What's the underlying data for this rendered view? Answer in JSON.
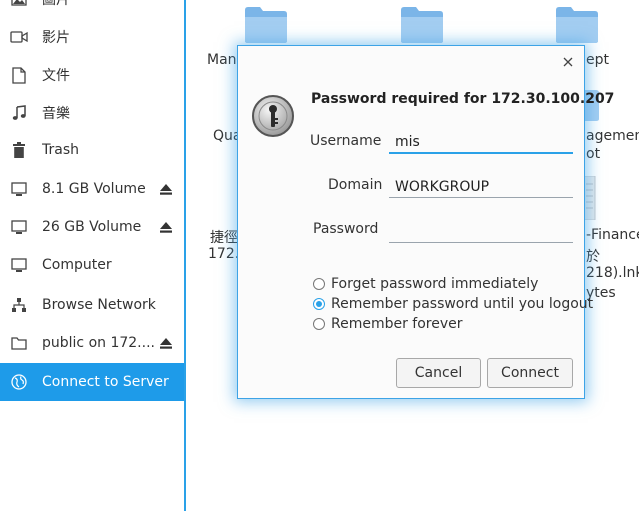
{
  "sidebar": {
    "items": [
      {
        "label": "圖片",
        "icon": "image-icon"
      },
      {
        "label": "影片",
        "icon": "video-icon"
      },
      {
        "label": "文件",
        "icon": "document-icon"
      },
      {
        "label": "音樂",
        "icon": "music-icon"
      },
      {
        "label": "Trash",
        "icon": "trash-icon"
      },
      {
        "label": "8.1 GB Volume",
        "icon": "drive-icon",
        "eject": true
      },
      {
        "label": "26 GB Volume",
        "icon": "drive-icon",
        "eject": true
      },
      {
        "label": "Computer",
        "icon": "computer-icon"
      },
      {
        "label": "Browse Network",
        "icon": "network-icon"
      },
      {
        "label": "public on 172....",
        "icon": "folder-icon",
        "eject": true
      },
      {
        "label": "Connect to Server",
        "icon": "globe-icon",
        "active": true
      }
    ]
  },
  "files": {
    "labels": {
      "manu": "Manu",
      "ept": "ept",
      "qua": "Qua",
      "agement": "agement",
      "ot": "ot",
      "zhejing": "捷徑",
      "n172": "172.",
      "finance": "-Finance",
      "yu": "於",
      "lnk": "218).lnk",
      "bytes": "ytes"
    }
  },
  "dialog": {
    "title": "Password required for 172.30.100.207",
    "username_label": "Username",
    "username_value": "mis",
    "domain_label": "Domain",
    "domain_value": "WORKGROUP",
    "password_label": "Password",
    "password_value": "",
    "options": [
      {
        "label": "Forget password immediately",
        "checked": false
      },
      {
        "label": "Remember password until you logout",
        "checked": true
      },
      {
        "label": "Remember forever",
        "checked": false
      }
    ],
    "cancel_label": "Cancel",
    "connect_label": "Connect"
  }
}
